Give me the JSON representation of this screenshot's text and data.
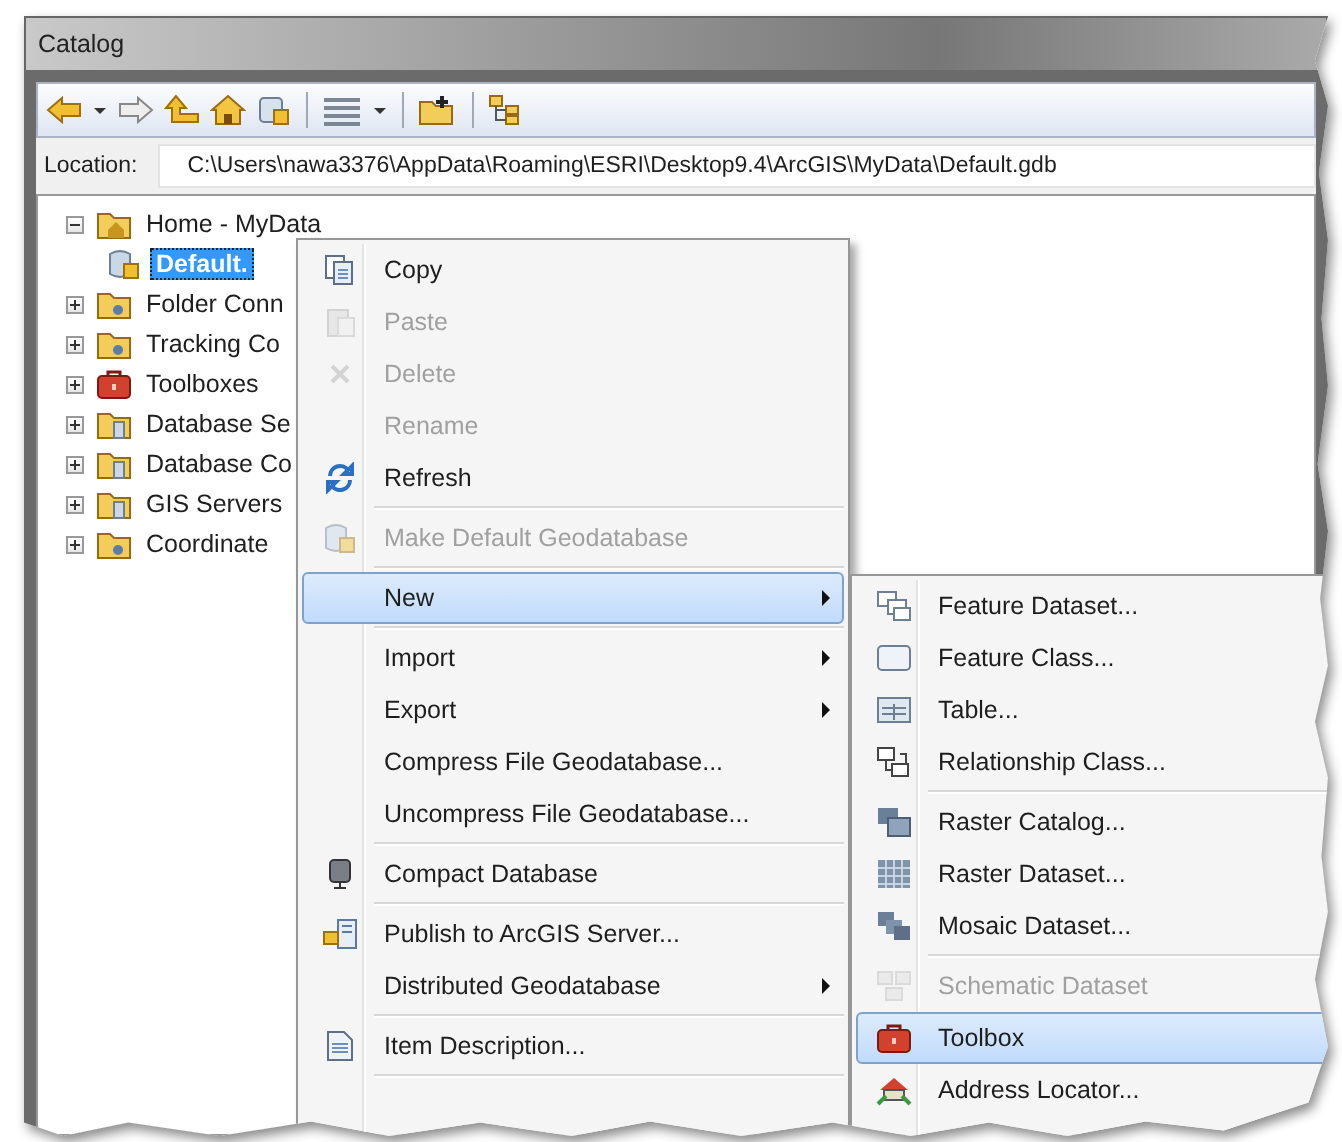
{
  "window": {
    "title": "Catalog"
  },
  "toolbar": {
    "buttons": [
      {
        "kind": "back"
      },
      {
        "kind": "caret"
      },
      {
        "kind": "forward"
      },
      {
        "kind": "up"
      },
      {
        "kind": "home"
      },
      {
        "kind": "connect"
      },
      {
        "kind": "sep"
      },
      {
        "kind": "grid"
      },
      {
        "kind": "caret"
      },
      {
        "kind": "sep"
      },
      {
        "kind": "folder-add"
      },
      {
        "kind": "sep"
      },
      {
        "kind": "tree"
      }
    ]
  },
  "location": {
    "label": "Location:",
    "value": "C:\\Users\\nawa3376\\AppData\\Roaming\\ESRI\\Desktop9.4\\ArcGIS\\MyData\\Default.gdb"
  },
  "tree": [
    {
      "label": "Home - MyData",
      "expanded": true,
      "selected": false,
      "children": [
        {
          "label": "Default.",
          "selected": true
        }
      ]
    },
    {
      "label": "Folder Conn",
      "expanded": false,
      "selected": false
    },
    {
      "label": "Tracking Co",
      "expanded": false,
      "selected": false
    },
    {
      "label": "Toolboxes",
      "expanded": false,
      "selected": false
    },
    {
      "label": "Database Se",
      "expanded": false,
      "selected": false
    },
    {
      "label": "Database Co",
      "expanded": false,
      "selected": false
    },
    {
      "label": "GIS Servers",
      "expanded": false,
      "selected": false
    },
    {
      "label": "Coordinate",
      "expanded": false,
      "selected": false
    }
  ],
  "context_menu": [
    {
      "kind": "item",
      "label": "Copy",
      "disabled": false,
      "submenu": false,
      "selected": false
    },
    {
      "kind": "item",
      "label": "Paste",
      "disabled": true,
      "submenu": false,
      "selected": false
    },
    {
      "kind": "item",
      "label": "Delete",
      "disabled": true,
      "submenu": false,
      "selected": false
    },
    {
      "kind": "item",
      "label": "Rename",
      "disabled": true,
      "submenu": false,
      "selected": false
    },
    {
      "kind": "item",
      "label": "Refresh",
      "disabled": false,
      "submenu": false,
      "selected": false
    },
    {
      "kind": "separator"
    },
    {
      "kind": "item",
      "label": "Make Default Geodatabase",
      "disabled": true,
      "submenu": false,
      "selected": false
    },
    {
      "kind": "separator"
    },
    {
      "kind": "item",
      "label": "New",
      "disabled": false,
      "submenu": true,
      "selected": true
    },
    {
      "kind": "separator"
    },
    {
      "kind": "item",
      "label": "Import",
      "disabled": false,
      "submenu": true,
      "selected": false
    },
    {
      "kind": "item",
      "label": "Export",
      "disabled": false,
      "submenu": true,
      "selected": false
    },
    {
      "kind": "item",
      "label": "Compress File Geodatabase...",
      "disabled": false,
      "submenu": false,
      "selected": false
    },
    {
      "kind": "item",
      "label": "Uncompress File Geodatabase...",
      "disabled": false,
      "submenu": false,
      "selected": false
    },
    {
      "kind": "separator"
    },
    {
      "kind": "item",
      "label": "Compact Database",
      "disabled": false,
      "submenu": false,
      "selected": false
    },
    {
      "kind": "separator"
    },
    {
      "kind": "item",
      "label": "Publish to ArcGIS Server...",
      "disabled": false,
      "submenu": false,
      "selected": false
    },
    {
      "kind": "item",
      "label": "Distributed Geodatabase",
      "disabled": false,
      "submenu": true,
      "selected": false
    },
    {
      "kind": "separator"
    },
    {
      "kind": "item",
      "label": "Item Description...",
      "disabled": false,
      "submenu": false,
      "selected": false
    },
    {
      "kind": "separator"
    }
  ],
  "new_submenu": [
    {
      "kind": "item",
      "label": "Feature Dataset...",
      "disabled": false,
      "selected": false
    },
    {
      "kind": "item",
      "label": "Feature Class...",
      "disabled": false,
      "selected": false
    },
    {
      "kind": "item",
      "label": "Table...",
      "disabled": false,
      "selected": false
    },
    {
      "kind": "item",
      "label": "Relationship Class...",
      "disabled": false,
      "selected": false
    },
    {
      "kind": "separator"
    },
    {
      "kind": "item",
      "label": "Raster Catalog...",
      "disabled": false,
      "selected": false
    },
    {
      "kind": "item",
      "label": "Raster Dataset...",
      "disabled": false,
      "selected": false
    },
    {
      "kind": "item",
      "label": "Mosaic Dataset...",
      "disabled": false,
      "selected": false
    },
    {
      "kind": "separator"
    },
    {
      "kind": "item",
      "label": "Schematic Dataset",
      "disabled": true,
      "selected": false
    },
    {
      "kind": "item",
      "label": "Toolbox",
      "disabled": false,
      "selected": true
    },
    {
      "kind": "item",
      "label": "Address Locator...",
      "disabled": false,
      "selected": false
    }
  ]
}
